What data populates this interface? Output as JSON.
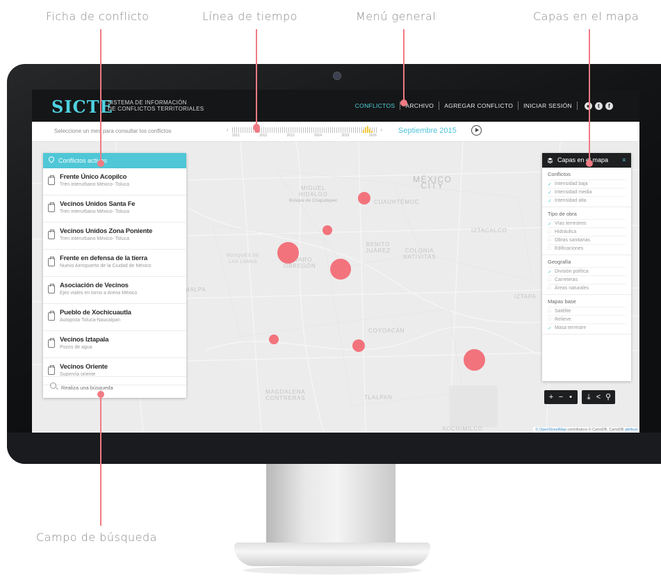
{
  "annotations": {
    "ficha": "Ficha de conflicto",
    "linea": "Línea de tiempo",
    "menu": "Menú general",
    "capas": "Capas en el mapa",
    "busqueda": "Campo de búsqueda"
  },
  "app": {
    "logo": "SICTE",
    "logo_sub_1": "SISTEMA DE INFORMACIÓN",
    "logo_sub_2": "DE CONFLICTOS TERRITORIALES"
  },
  "menu": {
    "items": [
      "CONFLICTOS",
      "ARCHIVO",
      "AGREGAR CONFLICTO",
      "INICIAR SESIÓN"
    ],
    "active_index": 0,
    "social_icons": [
      "globe-icon",
      "twitter-icon",
      "facebook-icon"
    ]
  },
  "timeline": {
    "hint": "Seleccione un mes para consultar los conflictos",
    "years": [
      "2011",
      "2012",
      "2013",
      "2014",
      "2015",
      "2016"
    ],
    "selected_period": "Septiembre 2015"
  },
  "conflicts_panel": {
    "title": "Conflictos activos",
    "items": [
      {
        "title": "Frente Único Acopilco",
        "subtitle": "Tren interurbano México- Toluca"
      },
      {
        "title": "Vecinos Unidos Santa Fe",
        "subtitle": "Tren interurbano México- Toluca"
      },
      {
        "title": "Vecinos Unidos Zona Poniente",
        "subtitle": "Tren interurbano México- Toluca"
      },
      {
        "title": "Frente en defensa de la tierra",
        "subtitle": "Nuevo Aeropuerto de la Ciudad de México"
      },
      {
        "title": "Asociación de Vecinos",
        "subtitle": "Ejes viales en torno a Arena México"
      },
      {
        "title": "Pueblo de Xochicuautla",
        "subtitle": "Autopista Toluca-Naucalpan"
      },
      {
        "title": "Vecinos Iztapala",
        "subtitle": "Pozos de agua"
      },
      {
        "title": "Vecinos Oriente",
        "subtitle": "Supervía oriente"
      }
    ],
    "search_placeholder": "Realiza una búsqueda"
  },
  "layers_panel": {
    "title": "Capas en el mapa",
    "groups": [
      {
        "name": "Conflictos",
        "options": [
          {
            "label": "Intensidad baja",
            "checked": true
          },
          {
            "label": "Intensidad media",
            "checked": true
          },
          {
            "label": "Intensidad alta",
            "checked": true
          }
        ]
      },
      {
        "name": "Tipo de obra",
        "options": [
          {
            "label": "Vías terrestres",
            "checked": true
          },
          {
            "label": "Hidráulica",
            "checked": false
          },
          {
            "label": "Obras sanitarias",
            "checked": false
          },
          {
            "label": "Edificaciones",
            "checked": false
          }
        ]
      },
      {
        "name": "Geografía",
        "options": [
          {
            "label": "División política",
            "checked": true
          },
          {
            "label": "Carreteras",
            "checked": false
          },
          {
            "label": "Áreas naturales",
            "checked": false
          }
        ]
      },
      {
        "name": "Mapas base",
        "options": [
          {
            "label": "Satélite",
            "checked": false
          },
          {
            "label": "Relieve",
            "checked": false
          },
          {
            "label": "Masa terrestre",
            "checked": true
          }
        ]
      }
    ]
  },
  "map": {
    "labels": {
      "mexico": "MÉXICO",
      "city": "CITY",
      "miguel": "MIGUEL",
      "hidalgo": "HIDALGO",
      "chapultepec": "Bosque de Chapultepec",
      "cuauhtemoc": "CUAUHTÉMOC",
      "iztacalco": "IZTACALCO",
      "benito": "BENITO",
      "juarez": "JUÁREZ",
      "colonia": "COLONIA",
      "nativitas": "NATIVITAS",
      "alvaro": "ÁLVARO",
      "obregon": "OBREGÓN",
      "bosques": "BOSQUES DE",
      "lomas": "LAS LOMAS",
      "cuajimalpa": "MALPA",
      "coyoacan": "COYOACÁN",
      "magdalena": "MAGDALENA",
      "contreras": "CONTRERAS",
      "tlalpan": "TLALPAN",
      "iztapalapa": "IZTAPA",
      "xochimilco": "XOCHIMILCO"
    },
    "accent_color": "#f26d76",
    "attribution_link": "© OpenStreetMap",
    "attribution_text": " contributors © CartoDB, CartoDB ",
    "attribution_tail": "attributi"
  },
  "tools": {
    "zoom": [
      "+",
      "−",
      "•"
    ],
    "actions": [
      "download-icon",
      "share-icon",
      "pin-icon"
    ]
  },
  "colors": {
    "brand": "#4fd1e0",
    "panel_header": "#4fc7d6",
    "marker": "#f26d76",
    "header_bg": "#151617"
  }
}
